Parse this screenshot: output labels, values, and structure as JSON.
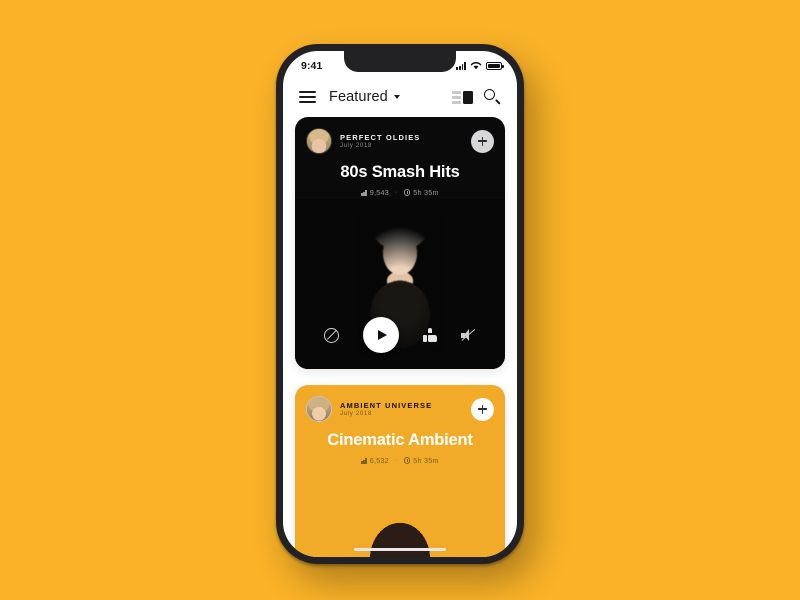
{
  "theme": {
    "page_background": "#fab328",
    "card_yellow": "#f2ab28",
    "card_dark": "#0a0a0a",
    "phone_frame": "#222225"
  },
  "status_bar": {
    "time": "9:41",
    "signal_icon": "signal-bars-icon",
    "wifi_icon": "wifi-icon",
    "battery_icon": "battery-icon"
  },
  "nav": {
    "menu_icon": "hamburger-menu-icon",
    "title": "Featured",
    "caret_icon": "chevron-down-icon",
    "layout_toggle_icon": "layout-toggle-icon",
    "search_icon": "search-icon"
  },
  "feed": {
    "cards": [
      {
        "channel": "PERFECT OLDIES",
        "date": "July 2018",
        "title": "80s Smash Hits",
        "plays": "9,543",
        "duration": "5h 35m",
        "add_label": "+",
        "theme": "dark",
        "controls": {
          "skip_label": "not-interested-icon",
          "play_label": "play-icon",
          "like_label": "thumbs-up-icon",
          "mute_label": "mute-icon"
        }
      },
      {
        "channel": "AMBIENT UNIVERSE",
        "date": "July 2018",
        "title": "Cinematic Ambient",
        "plays": "6,532",
        "duration": "5h 35m",
        "add_label": "+",
        "theme": "yellow"
      }
    ]
  }
}
